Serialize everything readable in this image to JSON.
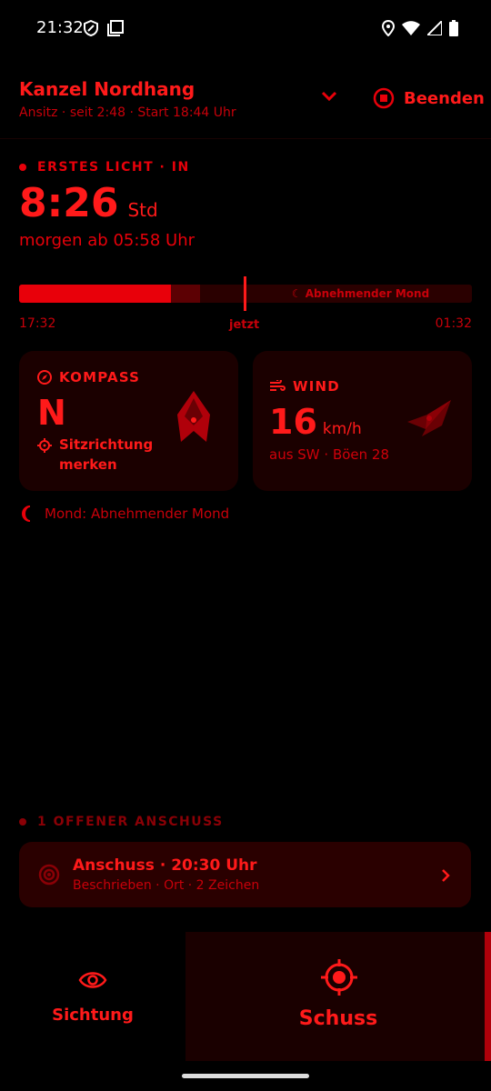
{
  "status_bar": {
    "time": "21:32"
  },
  "header": {
    "title": "Kanzel Nordhang",
    "subtitle": "Ansitz · seit 2:48 · Start 18:44 Uhr",
    "stop_label": "Beenden"
  },
  "first_light": {
    "label": "ERSTES LICHT · IN",
    "value": "8:26",
    "unit": "Std",
    "note": "morgen ab 05:58 Uhr"
  },
  "timeline": {
    "start": "17:32",
    "now": "jetzt",
    "end": "01:32",
    "moon_band_label": "☾ Abnehmender Mond",
    "progress": 0.5
  },
  "compass": {
    "label": "KOMPASS",
    "direction": "N",
    "action_line1": "Sitzrichtung",
    "action_line2": "merken"
  },
  "wind": {
    "label": "WIND",
    "speed": "16",
    "unit": "km/h",
    "detail": "aus SW · Böen 28"
  },
  "moon": {
    "text": "Mond: Abnehmender Mond"
  },
  "anschuss": {
    "section_label": "1 OFFENER ANSCHUSS",
    "title": "Anschuss · 20:30 Uhr",
    "subtitle": "Beschrieben · Ort · 2 Zeichen"
  },
  "bottom_nav": {
    "sichtung_label": "Sichtung",
    "schuss_label": "Schuss"
  },
  "colors": {
    "accent": "#e8000a",
    "background": "#000000",
    "card": "#1b0000"
  }
}
